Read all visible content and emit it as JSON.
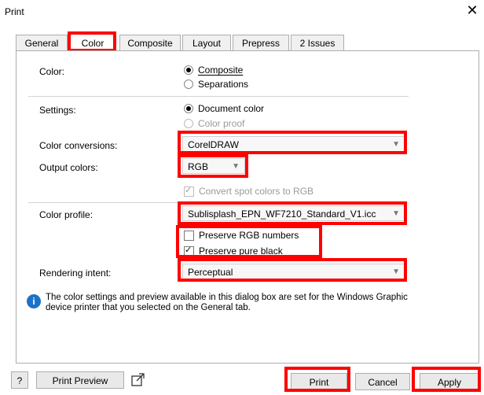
{
  "window": {
    "title": "Print",
    "close_glyph": "✕"
  },
  "tabs": [
    {
      "label": "General"
    },
    {
      "label": "Color"
    },
    {
      "label": "Composite"
    },
    {
      "label": "Layout"
    },
    {
      "label": "Prepress"
    },
    {
      "label": "2 Issues"
    }
  ],
  "color": {
    "label": "Color:",
    "options": [
      {
        "label": "Composite",
        "selected": true
      },
      {
        "label": "Separations",
        "selected": false
      }
    ]
  },
  "settings": {
    "label": "Settings:",
    "options": [
      {
        "label": "Document color",
        "selected": true
      },
      {
        "label": "Color proof",
        "selected": false
      }
    ]
  },
  "color_conversions": {
    "label": "Color conversions:",
    "value": "CorelDRAW"
  },
  "output_colors": {
    "label": "Output colors:",
    "value": "RGB"
  },
  "convert_spot": {
    "label": "Convert spot colors to RGB",
    "checked": true,
    "disabled": true
  },
  "color_profile": {
    "label": "Color profile:",
    "value": "Sublisplash_EPN_WF7210_Standard_V1.icc"
  },
  "preserve_rgb": {
    "label": "Preserve RGB numbers",
    "checked": false
  },
  "preserve_black": {
    "label": "Preserve pure black",
    "checked": true
  },
  "rendering_intent": {
    "label": "Rendering intent:",
    "value": "Perceptual"
  },
  "info_text": "The color settings and preview available in this dialog box are set for the Windows Graphic device printer that you selected on the General tab.",
  "buttons": {
    "help": "?",
    "print_preview": "Print Preview",
    "print": "Print",
    "cancel": "Cancel",
    "apply": "Apply"
  },
  "colors": {
    "highlight": "#ff0000",
    "info_blue": "#1a73c9"
  }
}
